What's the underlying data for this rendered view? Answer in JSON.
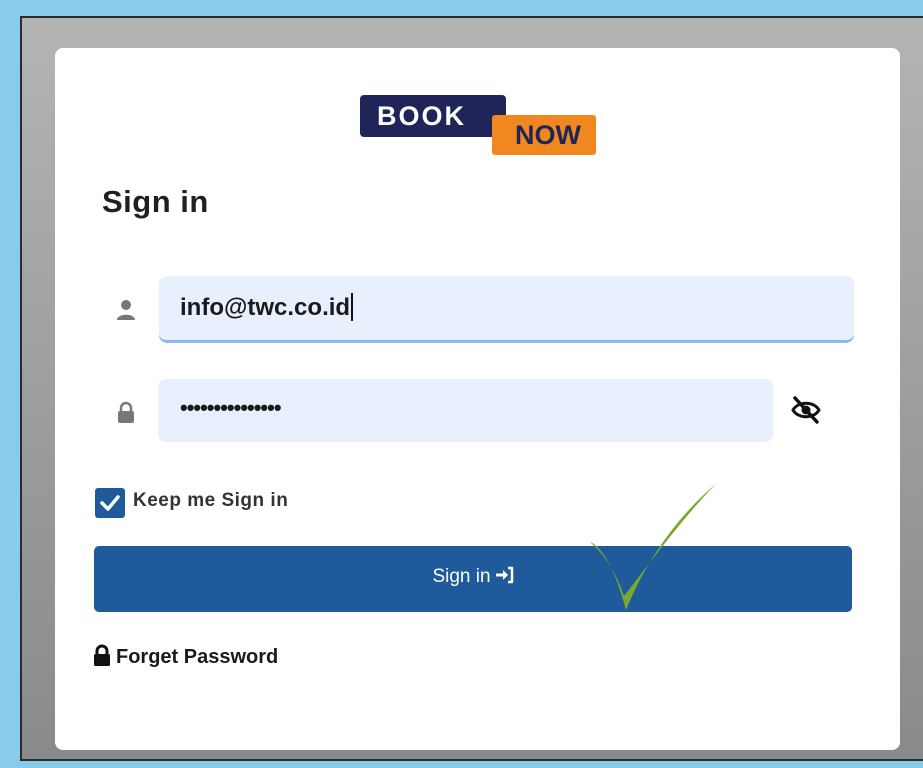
{
  "logo": {
    "word1": "BOOK",
    "word2": "NOW",
    "colors": {
      "navy": "#1f2558",
      "orange": "#f0871f"
    }
  },
  "title": "Sign in",
  "email": {
    "value": "info@twc.co.id",
    "icon": "user-icon"
  },
  "password": {
    "value": "•••••••••••••••",
    "icon": "lock-icon",
    "toggle_icon": "eye-slash-icon"
  },
  "remember": {
    "label": "Keep me Sign in",
    "checked": true
  },
  "submit": {
    "label": "Sign in",
    "icon": "sign-in-icon",
    "color": "#1f5a9a"
  },
  "forgot": {
    "label": "Forget Password",
    "icon": "lock-icon"
  },
  "overlay": {
    "icon": "green-checkmark",
    "color": "#7aa82e"
  }
}
